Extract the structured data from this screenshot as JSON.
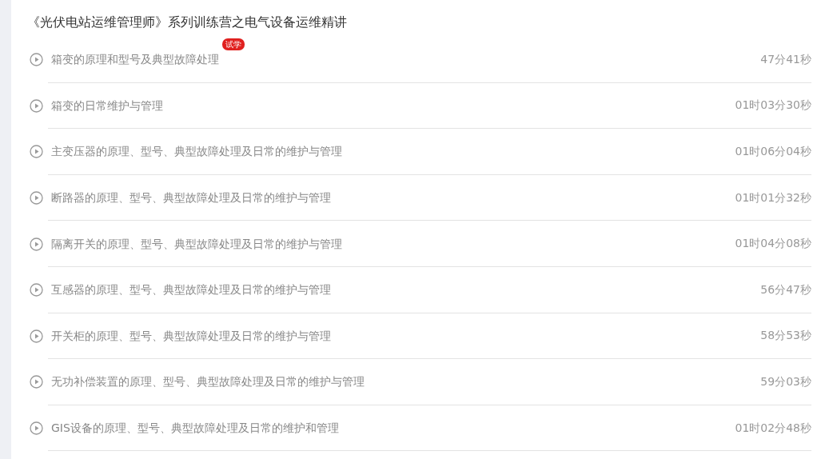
{
  "title": "《光伏电站运维管理师》系列训练营之电气设备运维精讲",
  "lessons": [
    {
      "title": "箱变的原理和型号及典型故障处理",
      "badge": "试学",
      "duration": "47分41秒"
    },
    {
      "title": "箱变的日常维护与管理",
      "duration": "01时03分30秒"
    },
    {
      "title": "主变压器的原理、型号、典型故障处理及日常的维护与管理",
      "duration": "01时06分04秒"
    },
    {
      "title": "断路器的原理、型号、典型故障处理及日常的维护与管理",
      "duration": "01时01分32秒"
    },
    {
      "title": "隔离开关的原理、型号、典型故障处理及日常的维护与管理",
      "duration": "01时04分08秒"
    },
    {
      "title": "互感器的原理、型号、典型故障处理及日常的维护与管理",
      "duration": "56分47秒"
    },
    {
      "title": "开关柜的原理、型号、典型故障处理及日常的维护与管理",
      "duration": "58分53秒"
    },
    {
      "title": "无功补偿装置的原理、型号、典型故障处理及日常的维护与管理",
      "duration": "59分03秒"
    },
    {
      "title": "GIS设备的原理、型号、典型故障处理及日常的维护和管理",
      "duration": "01时02分48秒"
    }
  ]
}
